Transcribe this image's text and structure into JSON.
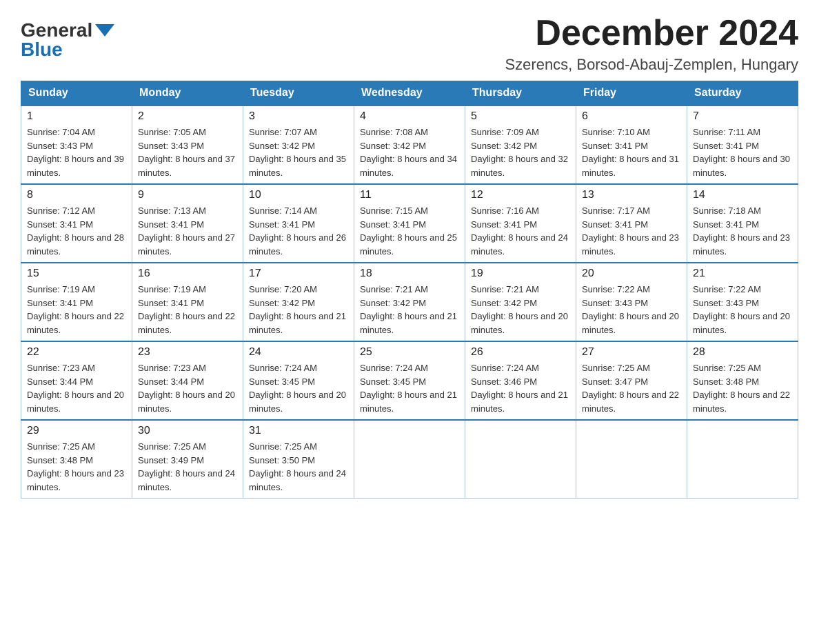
{
  "header": {
    "logo_general": "General",
    "logo_blue": "Blue",
    "title": "December 2024",
    "subtitle": "Szerencs, Borsod-Abauj-Zemplen, Hungary"
  },
  "weekdays": [
    "Sunday",
    "Monday",
    "Tuesday",
    "Wednesday",
    "Thursday",
    "Friday",
    "Saturday"
  ],
  "weeks": [
    [
      {
        "day": "1",
        "sunrise": "Sunrise: 7:04 AM",
        "sunset": "Sunset: 3:43 PM",
        "daylight": "Daylight: 8 hours and 39 minutes."
      },
      {
        "day": "2",
        "sunrise": "Sunrise: 7:05 AM",
        "sunset": "Sunset: 3:43 PM",
        "daylight": "Daylight: 8 hours and 37 minutes."
      },
      {
        "day": "3",
        "sunrise": "Sunrise: 7:07 AM",
        "sunset": "Sunset: 3:42 PM",
        "daylight": "Daylight: 8 hours and 35 minutes."
      },
      {
        "day": "4",
        "sunrise": "Sunrise: 7:08 AM",
        "sunset": "Sunset: 3:42 PM",
        "daylight": "Daylight: 8 hours and 34 minutes."
      },
      {
        "day": "5",
        "sunrise": "Sunrise: 7:09 AM",
        "sunset": "Sunset: 3:42 PM",
        "daylight": "Daylight: 8 hours and 32 minutes."
      },
      {
        "day": "6",
        "sunrise": "Sunrise: 7:10 AM",
        "sunset": "Sunset: 3:41 PM",
        "daylight": "Daylight: 8 hours and 31 minutes."
      },
      {
        "day": "7",
        "sunrise": "Sunrise: 7:11 AM",
        "sunset": "Sunset: 3:41 PM",
        "daylight": "Daylight: 8 hours and 30 minutes."
      }
    ],
    [
      {
        "day": "8",
        "sunrise": "Sunrise: 7:12 AM",
        "sunset": "Sunset: 3:41 PM",
        "daylight": "Daylight: 8 hours and 28 minutes."
      },
      {
        "day": "9",
        "sunrise": "Sunrise: 7:13 AM",
        "sunset": "Sunset: 3:41 PM",
        "daylight": "Daylight: 8 hours and 27 minutes."
      },
      {
        "day": "10",
        "sunrise": "Sunrise: 7:14 AM",
        "sunset": "Sunset: 3:41 PM",
        "daylight": "Daylight: 8 hours and 26 minutes."
      },
      {
        "day": "11",
        "sunrise": "Sunrise: 7:15 AM",
        "sunset": "Sunset: 3:41 PM",
        "daylight": "Daylight: 8 hours and 25 minutes."
      },
      {
        "day": "12",
        "sunrise": "Sunrise: 7:16 AM",
        "sunset": "Sunset: 3:41 PM",
        "daylight": "Daylight: 8 hours and 24 minutes."
      },
      {
        "day": "13",
        "sunrise": "Sunrise: 7:17 AM",
        "sunset": "Sunset: 3:41 PM",
        "daylight": "Daylight: 8 hours and 23 minutes."
      },
      {
        "day": "14",
        "sunrise": "Sunrise: 7:18 AM",
        "sunset": "Sunset: 3:41 PM",
        "daylight": "Daylight: 8 hours and 23 minutes."
      }
    ],
    [
      {
        "day": "15",
        "sunrise": "Sunrise: 7:19 AM",
        "sunset": "Sunset: 3:41 PM",
        "daylight": "Daylight: 8 hours and 22 minutes."
      },
      {
        "day": "16",
        "sunrise": "Sunrise: 7:19 AM",
        "sunset": "Sunset: 3:41 PM",
        "daylight": "Daylight: 8 hours and 22 minutes."
      },
      {
        "day": "17",
        "sunrise": "Sunrise: 7:20 AM",
        "sunset": "Sunset: 3:42 PM",
        "daylight": "Daylight: 8 hours and 21 minutes."
      },
      {
        "day": "18",
        "sunrise": "Sunrise: 7:21 AM",
        "sunset": "Sunset: 3:42 PM",
        "daylight": "Daylight: 8 hours and 21 minutes."
      },
      {
        "day": "19",
        "sunrise": "Sunrise: 7:21 AM",
        "sunset": "Sunset: 3:42 PM",
        "daylight": "Daylight: 8 hours and 20 minutes."
      },
      {
        "day": "20",
        "sunrise": "Sunrise: 7:22 AM",
        "sunset": "Sunset: 3:43 PM",
        "daylight": "Daylight: 8 hours and 20 minutes."
      },
      {
        "day": "21",
        "sunrise": "Sunrise: 7:22 AM",
        "sunset": "Sunset: 3:43 PM",
        "daylight": "Daylight: 8 hours and 20 minutes."
      }
    ],
    [
      {
        "day": "22",
        "sunrise": "Sunrise: 7:23 AM",
        "sunset": "Sunset: 3:44 PM",
        "daylight": "Daylight: 8 hours and 20 minutes."
      },
      {
        "day": "23",
        "sunrise": "Sunrise: 7:23 AM",
        "sunset": "Sunset: 3:44 PM",
        "daylight": "Daylight: 8 hours and 20 minutes."
      },
      {
        "day": "24",
        "sunrise": "Sunrise: 7:24 AM",
        "sunset": "Sunset: 3:45 PM",
        "daylight": "Daylight: 8 hours and 20 minutes."
      },
      {
        "day": "25",
        "sunrise": "Sunrise: 7:24 AM",
        "sunset": "Sunset: 3:45 PM",
        "daylight": "Daylight: 8 hours and 21 minutes."
      },
      {
        "day": "26",
        "sunrise": "Sunrise: 7:24 AM",
        "sunset": "Sunset: 3:46 PM",
        "daylight": "Daylight: 8 hours and 21 minutes."
      },
      {
        "day": "27",
        "sunrise": "Sunrise: 7:25 AM",
        "sunset": "Sunset: 3:47 PM",
        "daylight": "Daylight: 8 hours and 22 minutes."
      },
      {
        "day": "28",
        "sunrise": "Sunrise: 7:25 AM",
        "sunset": "Sunset: 3:48 PM",
        "daylight": "Daylight: 8 hours and 22 minutes."
      }
    ],
    [
      {
        "day": "29",
        "sunrise": "Sunrise: 7:25 AM",
        "sunset": "Sunset: 3:48 PM",
        "daylight": "Daylight: 8 hours and 23 minutes."
      },
      {
        "day": "30",
        "sunrise": "Sunrise: 7:25 AM",
        "sunset": "Sunset: 3:49 PM",
        "daylight": "Daylight: 8 hours and 24 minutes."
      },
      {
        "day": "31",
        "sunrise": "Sunrise: 7:25 AM",
        "sunset": "Sunset: 3:50 PM",
        "daylight": "Daylight: 8 hours and 24 minutes."
      },
      null,
      null,
      null,
      null
    ]
  ]
}
